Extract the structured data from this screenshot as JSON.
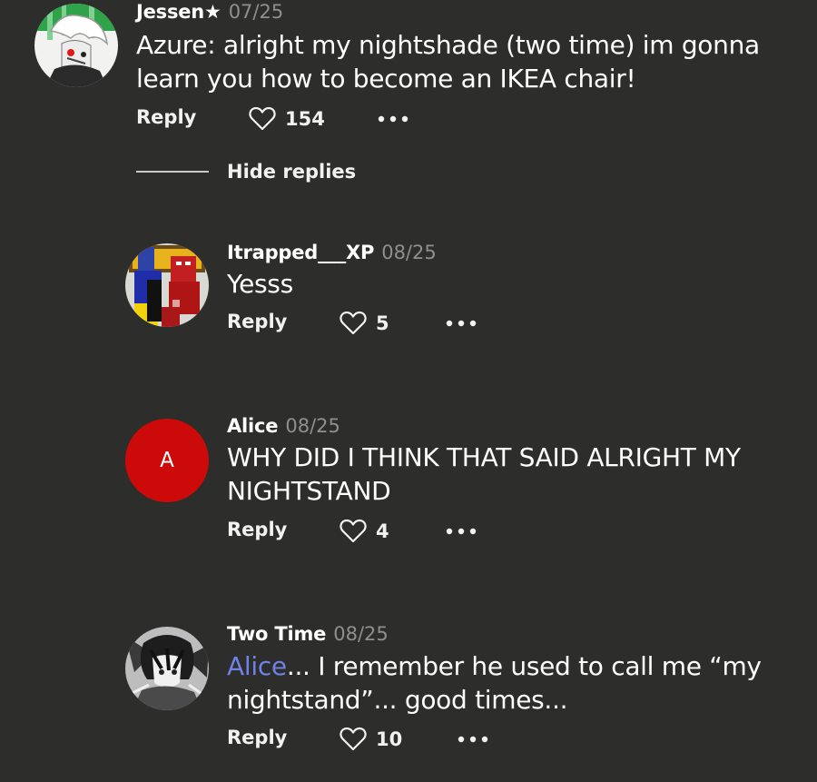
{
  "comments": [
    {
      "username": "Jessen★",
      "date": "07/25",
      "text": "Azure: alright my nightshade (two time) im gonna learn you how to become an IKEA chair!",
      "reply_label": "Reply",
      "likes": "154"
    },
    {
      "username": "Itrapped___XP",
      "date": "08/25",
      "text": "Yesss",
      "reply_label": "Reply",
      "likes": "5"
    },
    {
      "username": "Alice",
      "date": "08/25",
      "avatar_letter": "A",
      "text": "WHY DID I THINK THAT SAID ALRIGHT MY NIGHTSTAND",
      "reply_label": "Reply",
      "likes": "4"
    },
    {
      "username": "Two Time",
      "date": "08/25",
      "mention": "Alice",
      "text": "... I remember he used to call me “my nightstand”... good times...",
      "reply_label": "Reply",
      "likes": "10"
    }
  ],
  "hide_replies_label": "Hide replies",
  "colors": {
    "background": "#2d2d2b",
    "mention": "#6f82e6",
    "date": "#8f8f8f",
    "alice_avatar": "#cc0a0a"
  },
  "icons": {
    "like": "heart-outline-icon",
    "more": "more-dots-icon"
  }
}
